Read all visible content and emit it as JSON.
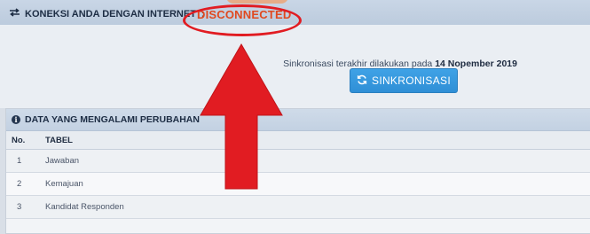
{
  "connection": {
    "title": "KONEKSI ANDA DENGAN INTERNET",
    "separator": ":",
    "status": "DISCONNECTED"
  },
  "sync": {
    "text_prefix": "Sinkronisasi terakhir dilakukan pada",
    "date": "14 Nopember 2019",
    "button_label": "SINKRONISASI"
  },
  "changes": {
    "title": "DATA YANG MENGALAMI PERUBAHAN",
    "columns": [
      "No.",
      "TABEL"
    ],
    "rows": [
      {
        "no": "1",
        "table": "Jawaban"
      },
      {
        "no": "2",
        "table": "Kemajuan"
      },
      {
        "no": "3",
        "table": "Kandidat Responden"
      }
    ]
  },
  "colors": {
    "status_text": "#e0491f",
    "annotation_red": "#e11c22",
    "button_blue": "#3a9be0"
  },
  "icons": [
    "exchange-icon",
    "refresh-icon",
    "info-circle-icon"
  ]
}
